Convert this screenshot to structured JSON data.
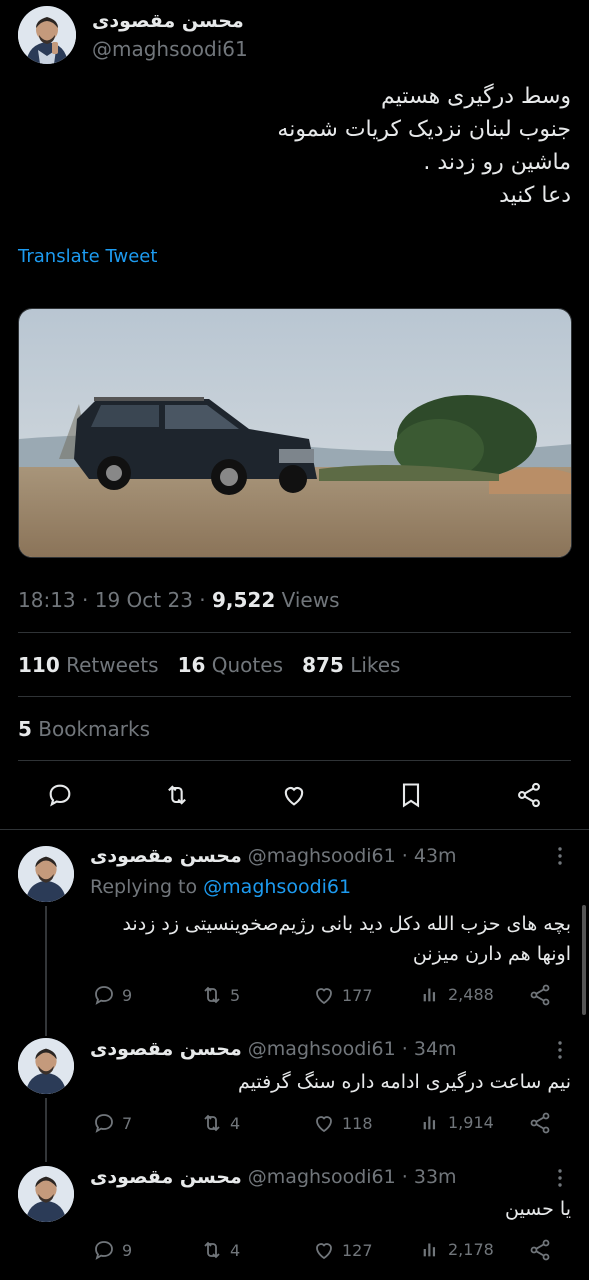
{
  "tweet": {
    "author_name": "محسن مقصودی",
    "author_handle": "@maghsoodi61",
    "text_lines": [
      "وسط درگیری هستیم",
      "جنوب لبنان نزدیک کریات شمونه",
      "ماشین رو زدند .",
      "دعا کنید"
    ],
    "translate_label": "Translate Tweet",
    "time": "18:13",
    "date": "19 Oct 23",
    "views_count": "9,522",
    "views_label": "Views",
    "retweets_count": "110",
    "retweets_label": "Retweets",
    "quotes_count": "16",
    "quotes_label": "Quotes",
    "likes_count": "875",
    "likes_label": "Likes",
    "bookmarks_count": "5",
    "bookmarks_label": "Bookmarks"
  },
  "replies": [
    {
      "author_name": "محسن مقصودی",
      "author_handle": "@maghsoodi61",
      "age": "43m",
      "replying_to_label": "Replying to",
      "replying_to_handle": "@maghsoodi61",
      "text_lines": [
        "بچه های حزب الله دکل دید بانی رژیم‌صخوینسیتی زد زدند",
        "اونها هم دارن میزنن"
      ],
      "replies": "9",
      "retweets": "5",
      "likes": "177",
      "views": "2,488"
    },
    {
      "author_name": "محسن مقصودی",
      "author_handle": "@maghsoodi61",
      "age": "34m",
      "text_lines": [
        "نیم ساعت درگیری ادامه داره سنگ گرفتیم"
      ],
      "replies": "7",
      "retweets": "4",
      "likes": "118",
      "views": "1,914"
    },
    {
      "author_name": "محسن مقصودی",
      "author_handle": "@maghsoodi61",
      "age": "33m",
      "text_lines": [
        "یا حسین"
      ],
      "replies": "9",
      "retweets": "4",
      "likes": "127",
      "views": "2,178"
    }
  ],
  "separator": "·",
  "colors": {
    "background": "#000000",
    "text": "#e7e9ea",
    "muted": "#71767b",
    "link": "#1d9bf0",
    "divider": "#2f3336"
  }
}
